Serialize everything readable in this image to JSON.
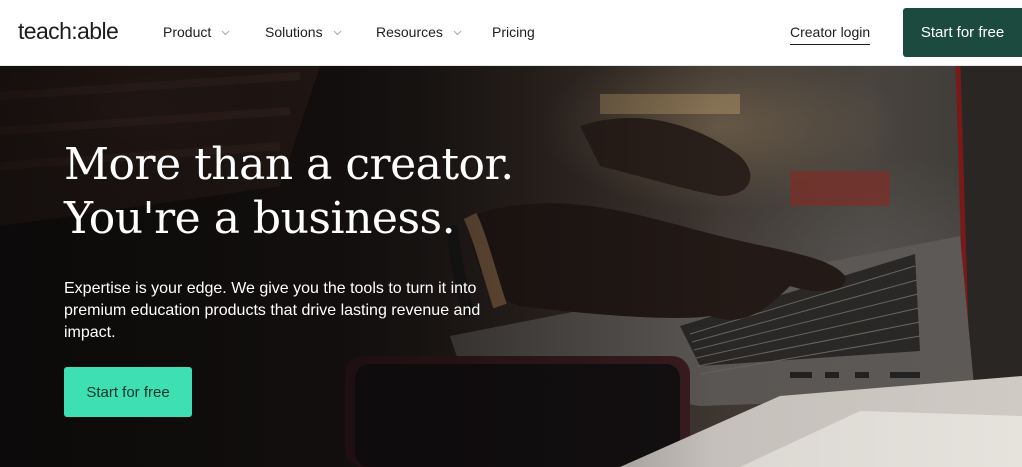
{
  "nav": {
    "logo": "teach:able",
    "menu": [
      {
        "label": "Product",
        "has_dropdown": true
      },
      {
        "label": "Solutions",
        "has_dropdown": true
      },
      {
        "label": "Resources",
        "has_dropdown": true
      },
      {
        "label": "Pricing",
        "has_dropdown": false
      }
    ],
    "login_label": "Creator login",
    "cta_label": "Start for free"
  },
  "hero": {
    "headline_line1": "More than a creator.",
    "headline_line2": "You're a business.",
    "subtext": "Expertise is your edge. We give you the tools to turn it into premium education products that drive lasting revenue and impact.",
    "cta_label": "Start for free",
    "background_image": "person-typing-on-laptop-photo"
  },
  "colors": {
    "nav_cta_bg": "#1c4a3e",
    "hero_cta_bg": "#3ee0b3",
    "text_dark": "#1d1d1f",
    "hero_text": "#ffffff"
  },
  "icons": {
    "dropdown": "chevron-down-icon"
  }
}
